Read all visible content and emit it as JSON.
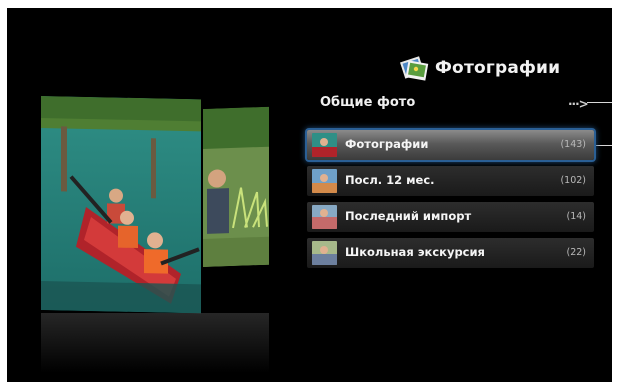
{
  "header": {
    "title": "Фотографии",
    "icon": "photos-app-icon"
  },
  "section": {
    "title": "Общие фото",
    "more_label": "···>"
  },
  "items": [
    {
      "label": "Фотографии",
      "count": "(143)",
      "selected": true
    },
    {
      "label": "Посл. 12 мес.",
      "count": "(102)",
      "selected": false
    },
    {
      "label": "Последний импорт",
      "count": "(14)",
      "selected": false
    },
    {
      "label": "Школьная экскурсия",
      "count": "(22)",
      "selected": false
    }
  ],
  "colors": {
    "background": "#000000",
    "selection_glow": "#2a5f95",
    "text": "#f5f5f5"
  }
}
